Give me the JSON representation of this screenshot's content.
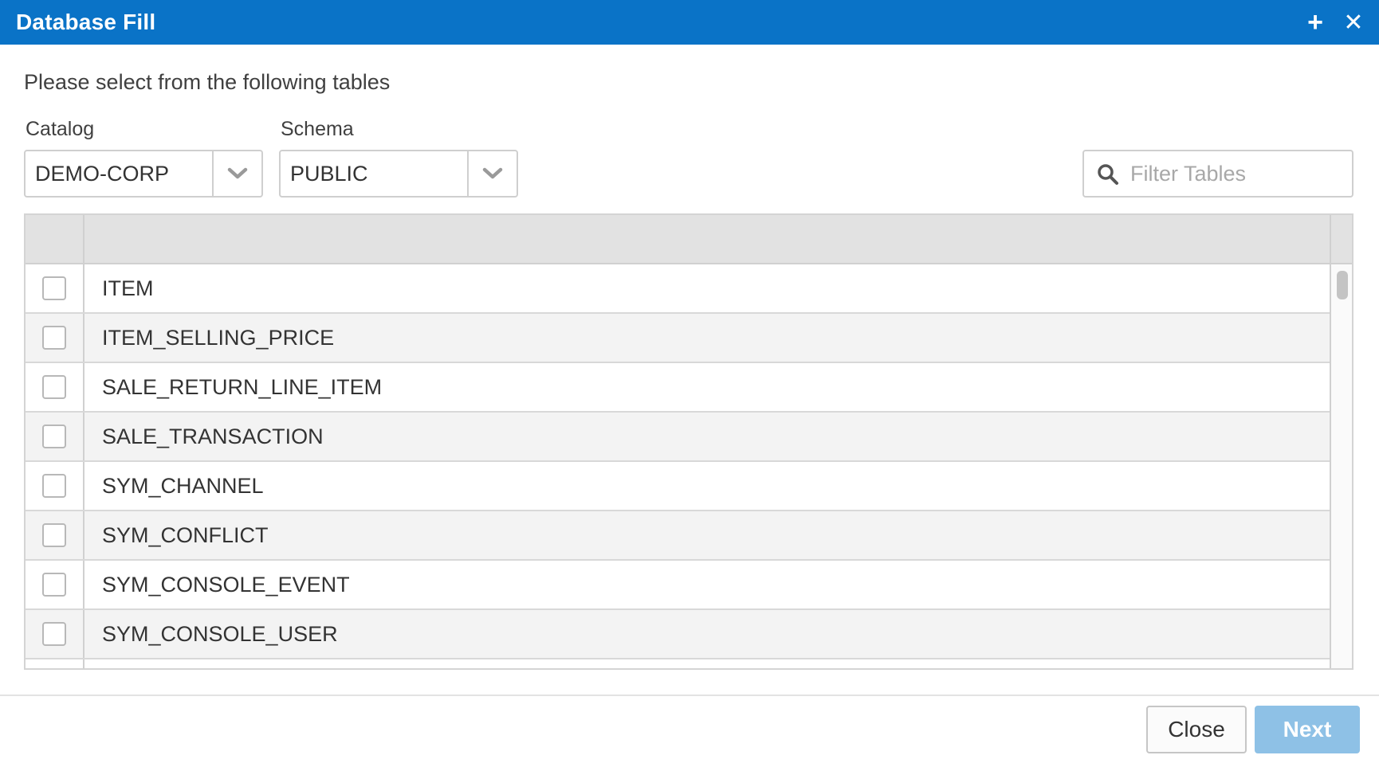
{
  "dialog": {
    "title": "Database Fill",
    "maximize_glyph": "+",
    "close_glyph": "✕",
    "instruction": "Please select from the following tables"
  },
  "catalog": {
    "label": "Catalog",
    "value": "DEMO-CORP",
    "icon": "chevron-down-icon"
  },
  "schema": {
    "label": "Schema",
    "value": "PUBLIC",
    "icon": "chevron-down-icon"
  },
  "filter": {
    "placeholder": "Filter Tables",
    "value": "",
    "icon": "search-icon"
  },
  "table": {
    "rows": [
      {
        "name": "ITEM",
        "checked": false
      },
      {
        "name": "ITEM_SELLING_PRICE",
        "checked": false
      },
      {
        "name": "SALE_RETURN_LINE_ITEM",
        "checked": false
      },
      {
        "name": "SALE_TRANSACTION",
        "checked": false
      },
      {
        "name": "SYM_CHANNEL",
        "checked": false
      },
      {
        "name": "SYM_CONFLICT",
        "checked": false
      },
      {
        "name": "SYM_CONSOLE_EVENT",
        "checked": false
      },
      {
        "name": "SYM_CONSOLE_USER",
        "checked": false
      },
      {
        "name": "",
        "checked": false
      }
    ]
  },
  "buttons": {
    "close": "Close",
    "next": "Next"
  },
  "colors": {
    "titlebar": "#0a73c7",
    "next_button": "#8ec1e6",
    "header_row": "#e2e2e2",
    "alt_row": "#f3f3f3"
  }
}
